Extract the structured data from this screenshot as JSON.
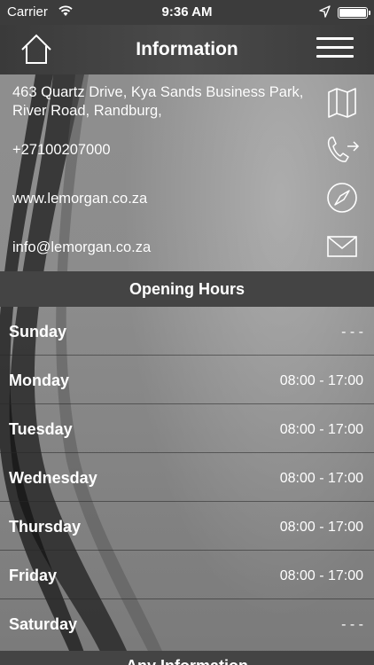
{
  "status_bar": {
    "carrier": "Carrier",
    "time": "9:36 AM"
  },
  "nav": {
    "title": "Information"
  },
  "contact": {
    "address": "463 Quartz Drive, Kya Sands Business Park, River Road, Randburg,",
    "phone": "+27100207000",
    "website": "www.lemorgan.co.za",
    "email": "info@lemorgan.co.za"
  },
  "opening_hours": {
    "header": "Opening Hours",
    "days": [
      {
        "day": "Sunday",
        "hours": "- - -"
      },
      {
        "day": "Monday",
        "hours": "08:00 - 17:00"
      },
      {
        "day": "Tuesday",
        "hours": "08:00 - 17:00"
      },
      {
        "day": "Wednesday",
        "hours": "08:00 - 17:00"
      },
      {
        "day": "Thursday",
        "hours": "08:00 - 17:00"
      },
      {
        "day": "Friday",
        "hours": "08:00 - 17:00"
      },
      {
        "day": "Saturday",
        "hours": "- - -"
      }
    ]
  },
  "next_section": {
    "header": "Any Information"
  }
}
